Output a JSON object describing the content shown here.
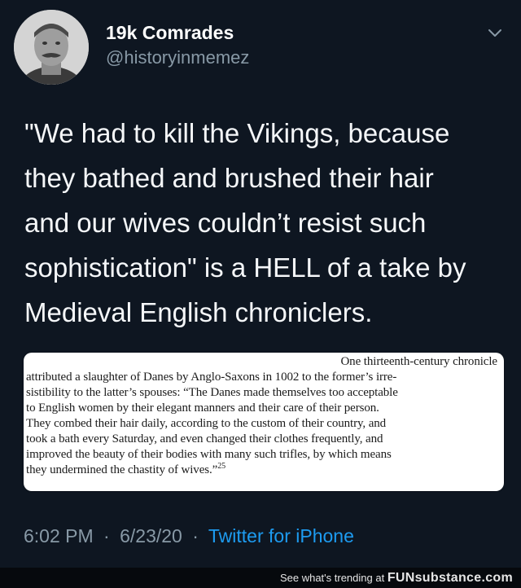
{
  "user": {
    "display_name": "19k Comrades",
    "handle": "@historyinmemez"
  },
  "icons": {
    "menu": "chevron-down-icon",
    "avatar": "avatar-portrait"
  },
  "tweet": {
    "lines": [
      "\"We had to kill the Vikings, because",
      "they bathed and brushed their hair",
      "and our wives couldn’t resist such",
      "sophistication\" is a HELL of a take by",
      "Medieval English chroniclers."
    ]
  },
  "excerpt": {
    "lines": [
      "One thirteenth-century chronicle",
      "attributed a slaughter of Danes by Anglo-Saxons in 1002 to the former’s irre-",
      "sistibility to the latter’s spouses: “The Danes made themselves too acceptable",
      "to English women by their elegant manners and their care of their person.",
      "They combed their hair daily, according to the custom of their country, and",
      "took a bath every Saturday, and even changed their clothes frequently, and",
      "improved the beauty of their bodies with many such trifles, by which means",
      "they undermined the chastity of wives.”"
    ],
    "footnote": "25"
  },
  "meta": {
    "time": "6:02 PM",
    "separator": "·",
    "date": "6/23/20",
    "client": "Twitter for iPhone"
  },
  "watermark": {
    "prefix": "See what's trending at",
    "brand": "FUNsubstance.com"
  },
  "colors": {
    "background": "#0e1621",
    "text": "#f5f7f9",
    "muted": "#8899a6",
    "link": "#1d9bf0"
  }
}
